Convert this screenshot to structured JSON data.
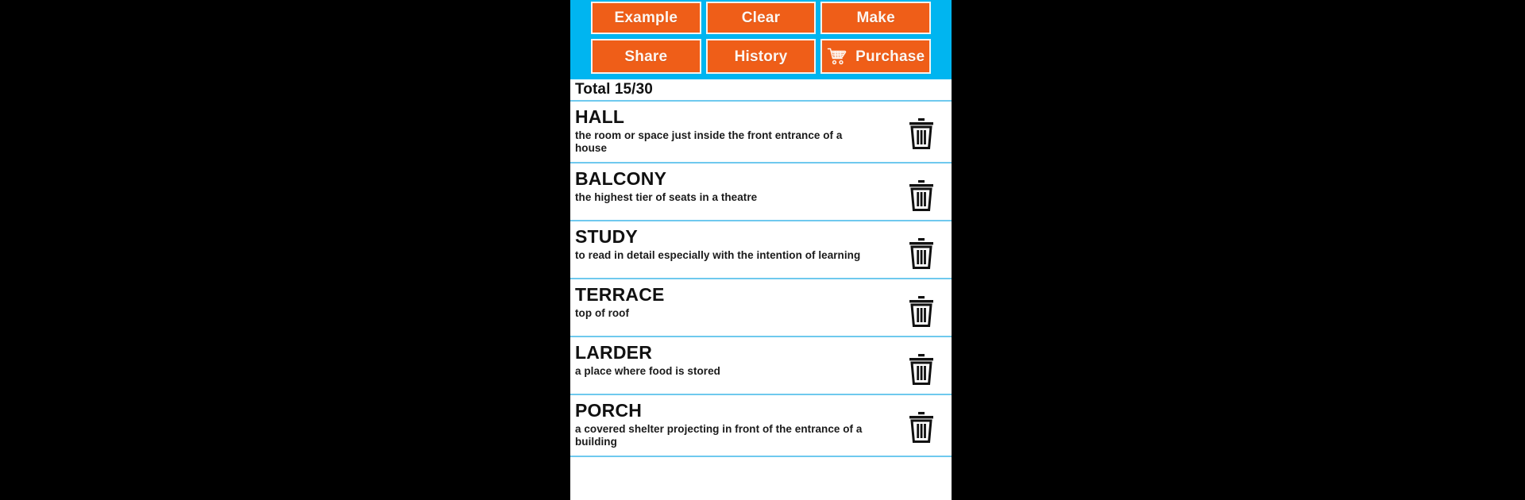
{
  "app": {
    "accent_cyan": "#00B5F0",
    "button_orange": "#EF5E18",
    "separator_blue": "#6FC9EE",
    "background": "#000000"
  },
  "toolbar": {
    "row1": [
      {
        "label": "Example",
        "icon": null
      },
      {
        "label": "Clear",
        "icon": null
      },
      {
        "label": "Make",
        "icon": null
      }
    ],
    "row2": [
      {
        "label": "Share",
        "icon": null
      },
      {
        "label": "History",
        "icon": null
      },
      {
        "label": "Purchase",
        "icon": "shopping-cart-icon"
      }
    ]
  },
  "total": {
    "label": "Total 15/30",
    "count": 15,
    "max": 30
  },
  "list": {
    "delete_icon": "trash-icon",
    "items": [
      {
        "term": "HALL",
        "definition": "the room or space just inside the front entrance of a house"
      },
      {
        "term": "BALCONY",
        "definition": "the highest tier of seats in a theatre"
      },
      {
        "term": "STUDY",
        "definition": "to read in detail especially with the intention of learning"
      },
      {
        "term": "TERRACE",
        "definition": "top of roof"
      },
      {
        "term": "LARDER",
        "definition": "a place where food is stored"
      },
      {
        "term": "PORCH",
        "definition": "a covered shelter projecting in front of the entrance of a building"
      }
    ]
  }
}
